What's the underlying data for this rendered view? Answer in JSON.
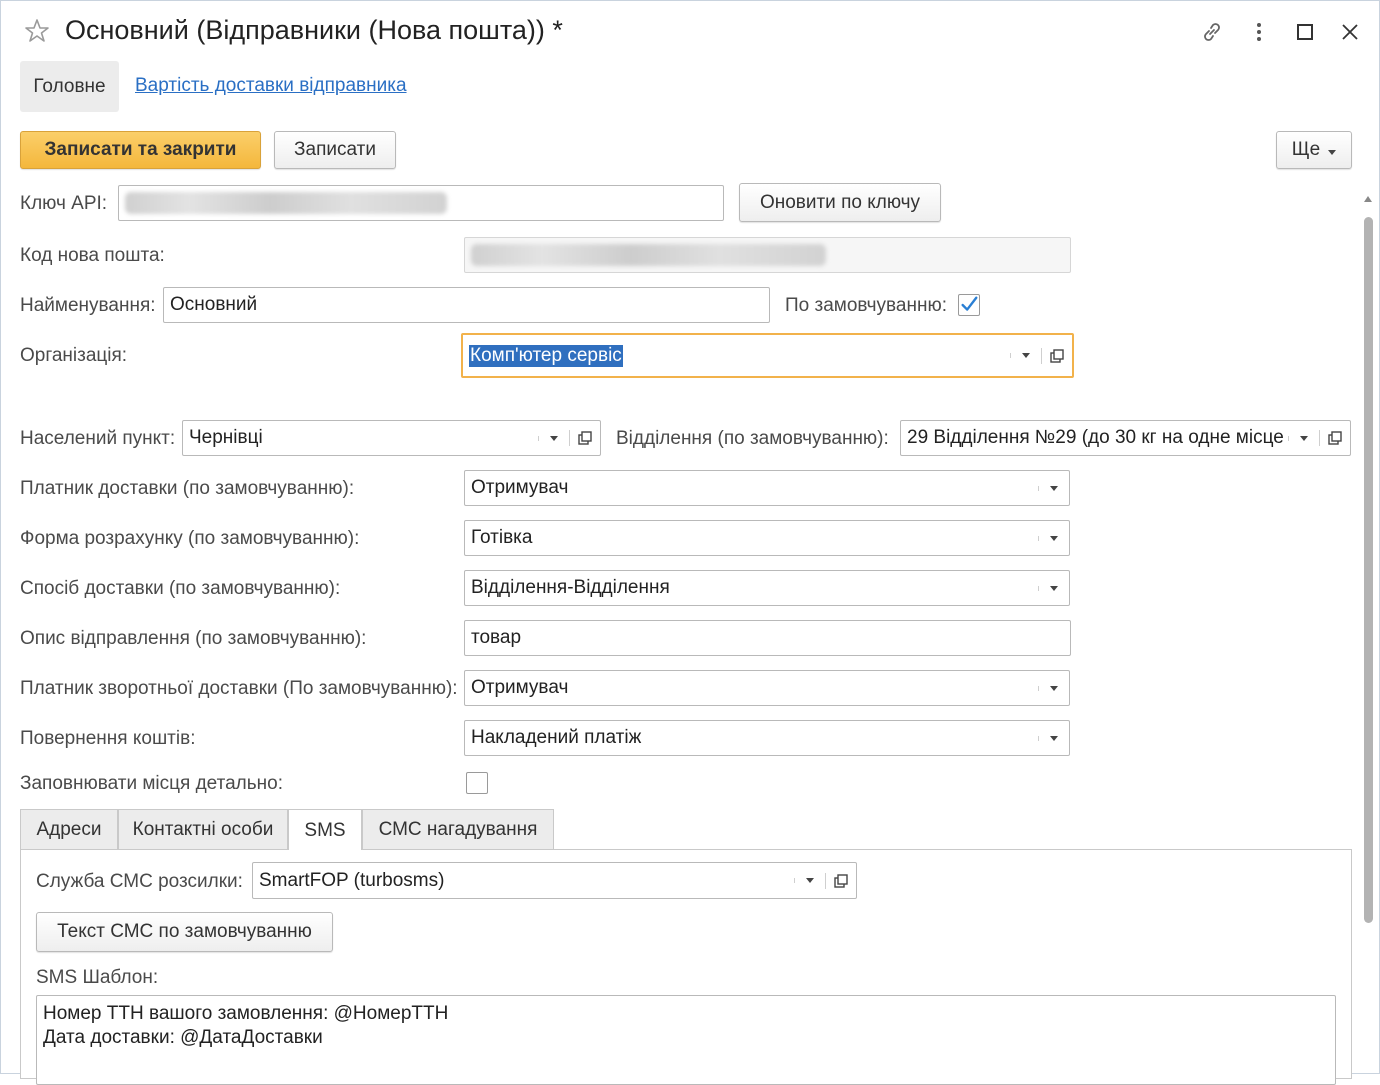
{
  "window": {
    "title": "Основний (Відправники (Нова пошта)) *"
  },
  "nav": {
    "main_label": "Головне",
    "link_label": "Вартість доставки відправника"
  },
  "toolbar": {
    "save_close_label": "Записати та закрити",
    "save_label": "Записати",
    "more_label": "Ще"
  },
  "form": {
    "api_key": {
      "label": "Ключ API:",
      "button_label": "Оновити по ключу"
    },
    "np_code": {
      "label": "Код нова пошта:"
    },
    "name": {
      "label": "Найменування:",
      "value": "Основний"
    },
    "default": {
      "label": "По замовчуванню:",
      "checked": true
    },
    "organization": {
      "label": "Організація:",
      "value": "Комп'ютер сервіс"
    },
    "city": {
      "label": "Населений пункт:",
      "value": "Чернівці"
    },
    "branch": {
      "label": "Відділення (по замовчуванню):",
      "value": "29 Відділення №29 (до 30 кг на одне місце"
    },
    "payer": {
      "label": "Платник доставки (по замовчуванню):",
      "value": "Отримувач"
    },
    "payment_form": {
      "label": "Форма розрахунку (по замовчуванню):",
      "value": "Готівка"
    },
    "delivery_method": {
      "label": "Спосіб доставки (по замовчуванню):",
      "value": "Відділення-Відділення"
    },
    "description": {
      "label": "Опис відправлення (по замовчуванню):",
      "value": "товар"
    },
    "return_payer": {
      "label": "Платник зворотньої доставки (По замовчуванню):",
      "value": "Отримувач"
    },
    "money_return": {
      "label": "Повернення коштів:",
      "value": "Накладений платіж"
    },
    "fill_places": {
      "label": "Заповнювати місця детально:",
      "checked": false
    }
  },
  "tabs": [
    {
      "label": "Адреси",
      "active": false
    },
    {
      "label": "Контактні особи",
      "active": false
    },
    {
      "label": "SMS",
      "active": true
    },
    {
      "label": "СМС нагадування",
      "active": false
    }
  ],
  "sms": {
    "service_label": "Служба СМС розсилки:",
    "service_value": "SmartFOP (turbosms)",
    "default_text_button": "Текст СМС по замовчуванню",
    "template_label": "SMS Шаблон:",
    "template_lines": [
      "Номер ТТН вашого замовлення: @НомерТТН",
      "Дата доставки: @ДатаДоставки"
    ]
  },
  "colors": {
    "primary_button": "#f4b73c",
    "link": "#2a6fc4",
    "focus_border": "#f2b24b",
    "checkbox_check": "#2a7fd4"
  }
}
